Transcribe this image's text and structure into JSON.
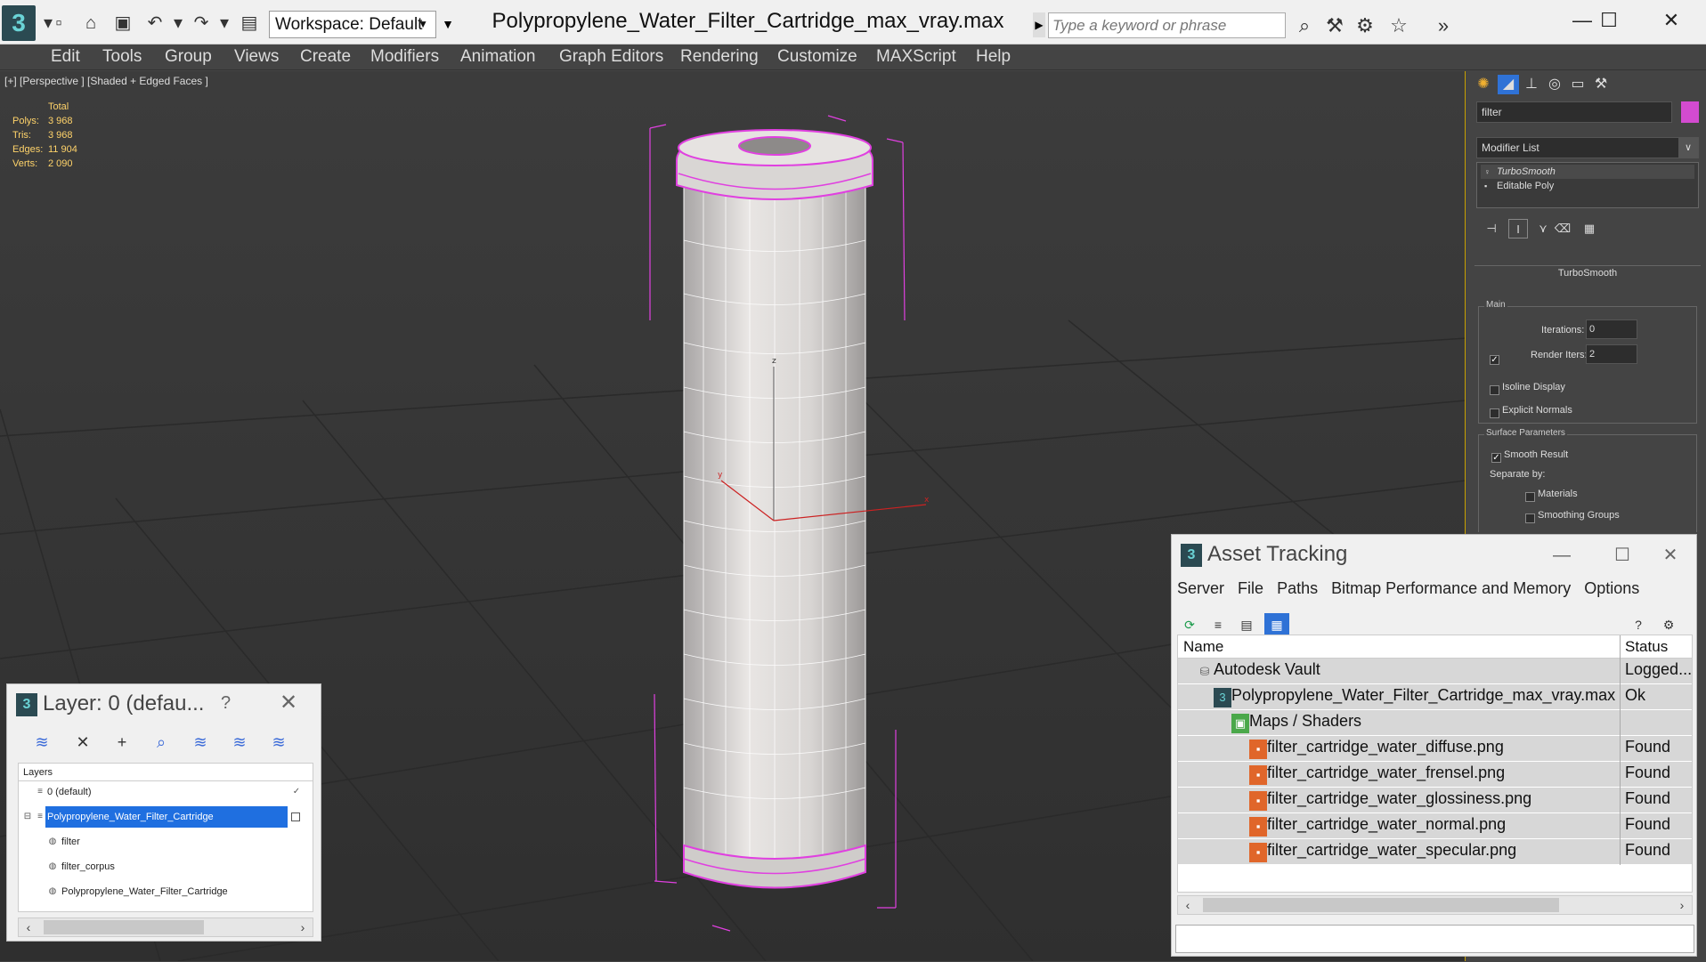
{
  "titlebar": {
    "doc_title": "Polypropylene_Water_Filter_Cartridge_max_vray.max",
    "workspace": "Workspace: Default",
    "search_placeholder": "Type a keyword or phrase"
  },
  "menu": [
    "Edit",
    "Tools",
    "Group",
    "Views",
    "Create",
    "Modifiers",
    "Animation",
    "Graph Editors",
    "Rendering",
    "Customize",
    "MAXScript",
    "Help"
  ],
  "viewport": {
    "label": "[+] [Perspective ] [Shaded + Edged Faces ]",
    "stats": {
      "header": "Total",
      "rows": [
        {
          "k": "Polys:",
          "v": "3 968"
        },
        {
          "k": "Tris:",
          "v": "3 968"
        },
        {
          "k": "Edges:",
          "v": "11 904"
        },
        {
          "k": "Verts:",
          "v": "2 090"
        }
      ]
    },
    "axes": {
      "x": "x",
      "y": "y",
      "z": "z"
    }
  },
  "command_panel": {
    "object_name": "filter",
    "object_color": "#d34bd0",
    "modifier_list": "Modifier List",
    "stack": [
      "TurboSmooth",
      "Editable Poly"
    ],
    "rollout_title": "TurboSmooth",
    "main_group": "Main",
    "iterations_label": "Iterations:",
    "iterations_value": "0",
    "render_iters_label": "Render Iters:",
    "render_iters_value": "2",
    "isoline_label": "Isoline Display",
    "explicit_normals_label": "Explicit Normals",
    "surface_group": "Surface Parameters",
    "smooth_result_label": "Smooth Result",
    "separate_by_label": "Separate by:",
    "materials_label": "Materials",
    "smoothing_groups_label": "Smoothing Groups"
  },
  "asset_tracking": {
    "title": "Asset Tracking",
    "menu": [
      "Server",
      "File",
      "Paths",
      "Bitmap Performance and Memory",
      "Options"
    ],
    "col_name": "Name",
    "col_status": "Status",
    "rows": [
      {
        "name": "Autodesk Vault",
        "status": "Logged...",
        "indent": 0
      },
      {
        "name": "Polypropylene_Water_Filter_Cartridge_max_vray.max",
        "status": "Ok",
        "indent": 1
      },
      {
        "name": "Maps / Shaders",
        "status": "",
        "indent": 2
      },
      {
        "name": "filter_cartridge_water_diffuse.png",
        "status": "Found",
        "indent": 3
      },
      {
        "name": "filter_cartridge_water_frensel.png",
        "status": "Found",
        "indent": 3
      },
      {
        "name": "filter_cartridge_water_glossiness.png",
        "status": "Found",
        "indent": 3
      },
      {
        "name": "filter_cartridge_water_normal.png",
        "status": "Found",
        "indent": 3
      },
      {
        "name": "filter_cartridge_water_specular.png",
        "status": "Found",
        "indent": 3
      }
    ]
  },
  "layer_panel": {
    "title": "Layer: 0 (defau...",
    "help": "?",
    "tree_header": "Layers",
    "rows": [
      {
        "name": "0 (default)",
        "indent": 0
      },
      {
        "name": "Polypropylene_Water_Filter_Cartridge",
        "indent": 0
      },
      {
        "name": "filter",
        "indent": 1
      },
      {
        "name": "filter_corpus",
        "indent": 1
      },
      {
        "name": "Polypropylene_Water_Filter_Cartridge",
        "indent": 1
      }
    ]
  }
}
